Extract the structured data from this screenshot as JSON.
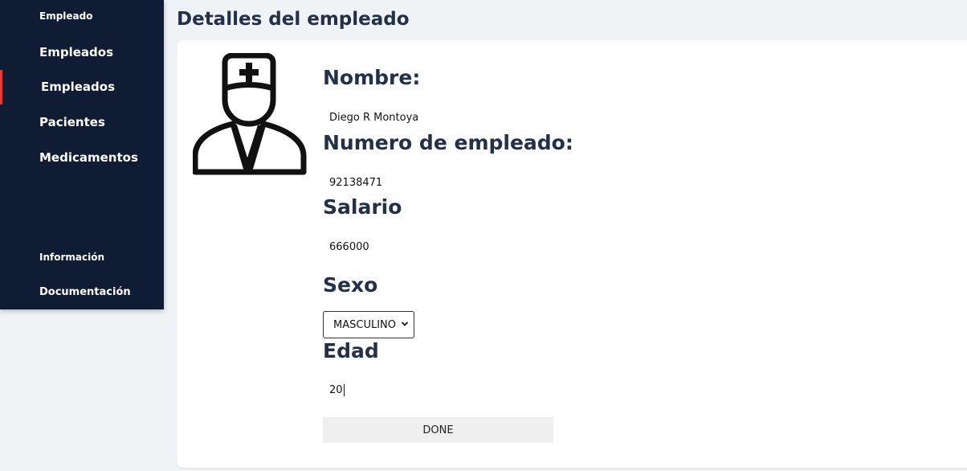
{
  "sidebar": {
    "section_employee": "Empleado",
    "items": [
      {
        "label": "Empleados"
      },
      {
        "label": "Empleados"
      },
      {
        "label": "Pacientes"
      },
      {
        "label": "Medicamentos"
      }
    ],
    "section_info": "Información",
    "documentation": "Documentación",
    "active_color": "#e03a3e",
    "background_color": "#101c33"
  },
  "page": {
    "title": "Detalles del empleado"
  },
  "avatar": {
    "icon": "doctor-icon"
  },
  "fields": {
    "name_label": "Nombre:",
    "name_value": "Diego R Montoya",
    "employee_number_label": "Numero de empleado:",
    "employee_number_value": "92138471",
    "salary_label": "Salario",
    "salary_value": "666000",
    "sex_label": "Sexo",
    "sex_selected": "MASCULINO",
    "age_label": "Edad",
    "age_value": "20"
  },
  "actions": {
    "done_label": "DONE"
  }
}
